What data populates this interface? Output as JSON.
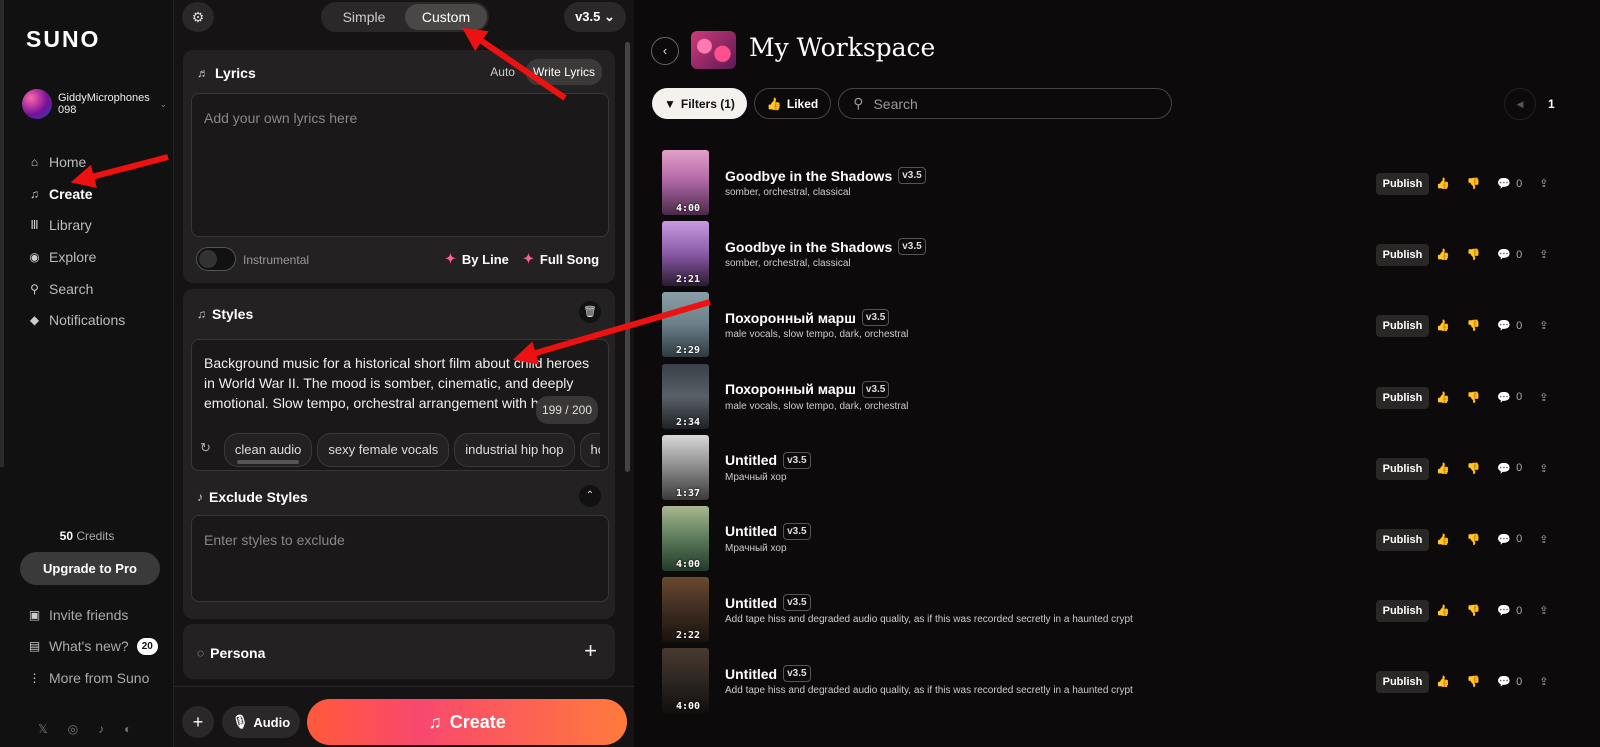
{
  "sidebar": {
    "logo": "SUNO",
    "user": "GiddyMicrophones098",
    "nav": [
      {
        "label": "Home",
        "icon": "home-icon"
      },
      {
        "label": "Create",
        "icon": "music-note-icon"
      },
      {
        "label": "Library",
        "icon": "library-icon"
      },
      {
        "label": "Explore",
        "icon": "compass-icon"
      },
      {
        "label": "Search",
        "icon": "search-icon"
      },
      {
        "label": "Notifications",
        "icon": "bell-icon"
      }
    ],
    "credits_num": "50",
    "credits_label": "Credits",
    "upgrade": "Upgrade to Pro",
    "bottom": [
      {
        "label": "Invite friends",
        "icon": "gift-icon"
      },
      {
        "label": "What's new?",
        "icon": "news-icon",
        "badge": "20"
      },
      {
        "label": "More from Suno",
        "icon": "more-icon"
      }
    ],
    "socials": [
      "x-icon",
      "instagram-icon",
      "tiktok-icon",
      "discord-icon"
    ]
  },
  "create": {
    "mode_simple": "Simple",
    "mode_custom": "Custom",
    "version": "v3.5",
    "lyrics": {
      "title": "Lyrics",
      "tab_auto": "Auto",
      "tab_write": "Write Lyrics",
      "placeholder": "Add your own lyrics here",
      "instrumental": "Instrumental",
      "by_line": "By Line",
      "full_song": "Full Song"
    },
    "styles": {
      "title": "Styles",
      "text": "Background music for a historical short film about child heroes in World War II. The mood is somber, cinematic, and deeply emotional. Slow tempo, orchestral arrangement with haunting strings, delic",
      "counter": "199 / 200",
      "chips": [
        "clean audio",
        "sexy female vocals",
        "industrial hip hop",
        "house"
      ]
    },
    "exclude": {
      "title": "Exclude Styles",
      "placeholder": "Enter styles to exclude"
    },
    "persona": "Persona",
    "audio": "Audio",
    "create": "Create"
  },
  "workspace": {
    "title": "My Workspace",
    "filters": "Filters (1)",
    "liked": "Liked",
    "search_placeholder": "Search",
    "page": "1",
    "publish": "Publish",
    "songs": [
      {
        "title": "Goodbye in the Shadows",
        "version": "v3.5",
        "tags": "somber, orchestral, classical",
        "duration": "4:00",
        "likes": "0"
      },
      {
        "title": "Goodbye in the Shadows",
        "version": "v3.5",
        "tags": "somber, orchestral, classical",
        "duration": "2:21",
        "likes": "0"
      },
      {
        "title": "Похоронный марш",
        "version": "v3.5",
        "tags": "male vocals, slow tempo, dark, orchestral",
        "duration": "2:29",
        "likes": "0"
      },
      {
        "title": "Похоронный марш",
        "version": "v3.5",
        "tags": "male vocals, slow tempo, dark, orchestral",
        "duration": "2:34",
        "likes": "0"
      },
      {
        "title": "Untitled",
        "version": "v3.5",
        "tags": "Мрачный хор",
        "duration": "1:37",
        "likes": "0"
      },
      {
        "title": "Untitled",
        "version": "v3.5",
        "tags": "Мрачный хор",
        "duration": "4:00",
        "likes": "0"
      },
      {
        "title": "Untitled",
        "version": "v3.5",
        "tags": "Add tape hiss and degraded audio quality, as if this was recorded secretly in a haunted crypt",
        "duration": "2:22",
        "likes": "0"
      },
      {
        "title": "Untitled",
        "version": "v3.5",
        "tags": "Add tape hiss and degraded audio quality, as if this was recorded secretly in a haunted crypt",
        "duration": "4:00",
        "likes": "0"
      }
    ]
  },
  "colors": {
    "accent_gradient_start": "#ff5a3a",
    "accent_gradient_end": "#ff7a3c",
    "spark": "#ff5d9e",
    "annotation_arrow": "#ee1111"
  }
}
